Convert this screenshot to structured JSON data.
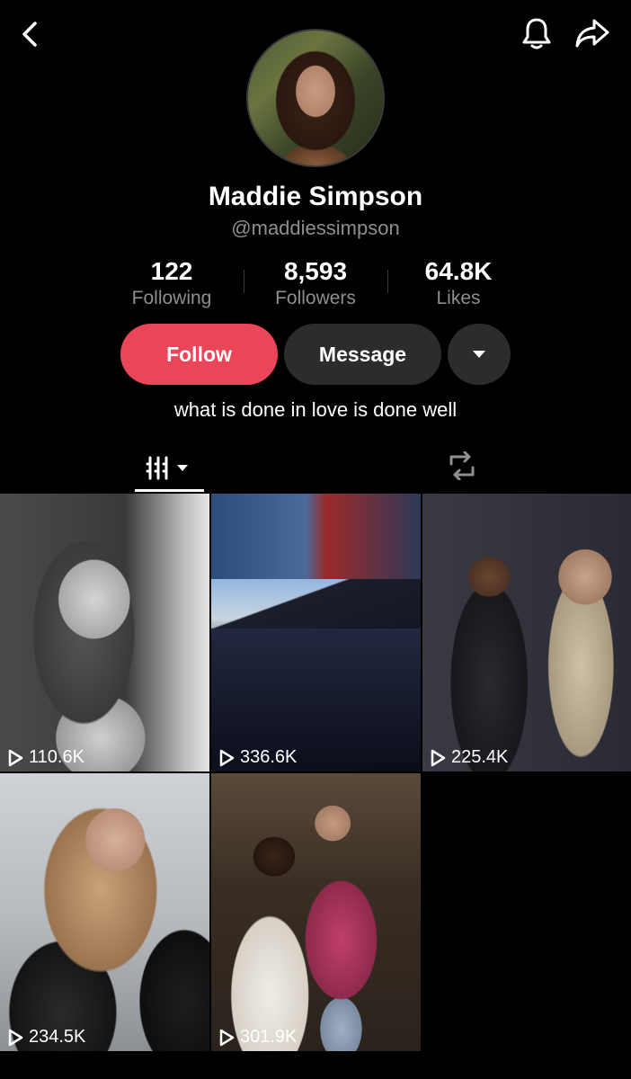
{
  "profile": {
    "display_name": "Maddie Simpson",
    "username": "@maddiessimpson",
    "bio": "what is done in love is done well"
  },
  "stats": {
    "following": {
      "value": "122",
      "label": "Following"
    },
    "followers": {
      "value": "8,593",
      "label": "Followers"
    },
    "likes": {
      "value": "64.8K",
      "label": "Likes"
    }
  },
  "actions": {
    "follow_label": "Follow",
    "message_label": "Message"
  },
  "colors": {
    "follow_accent": "#ea4559",
    "secondary_button": "#2c2c2c",
    "muted_text": "#8e8e8e"
  },
  "icons": {
    "back": "chevron-left-icon",
    "bell": "bell-icon",
    "share": "share-arrow-icon",
    "more": "caret-down-icon",
    "grid_tab": "grid-columns-icon",
    "repost_tab": "repost-icon",
    "play": "play-outline-icon"
  },
  "videos": [
    {
      "views": "110.6K"
    },
    {
      "views": "336.6K"
    },
    {
      "views": "225.4K"
    },
    {
      "views": "234.5K"
    },
    {
      "views": "301.9K"
    }
  ]
}
